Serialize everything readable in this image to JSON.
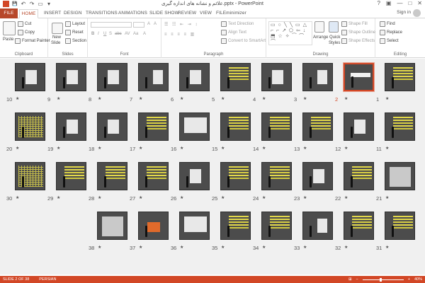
{
  "window": {
    "title": "علائم و نشانه های اندازه گیری.pptx - PowerPoint",
    "help": "?",
    "ribbon_display": "▣",
    "minimize": "—",
    "maximize": "□",
    "close": "✕"
  },
  "qat": {
    "save": "💾",
    "undo": "↶",
    "redo": "↷",
    "start": "▭",
    "customize": "▾"
  },
  "tabs": [
    "FILE",
    "HOME",
    "INSERT",
    "DESIGN",
    "TRANSITIONS",
    "ANIMATIONS",
    "SLIDE SHOW",
    "REVIEW",
    "VIEW",
    "FILEminimizer"
  ],
  "signin": "Sign in",
  "ribbon": {
    "clipboard": {
      "paste": "Paste",
      "cut": "Cut",
      "copy": "Copy",
      "format_painter": "Format Painter",
      "label": "Clipboard"
    },
    "slides": {
      "new_slide": "New",
      "new_slide2": "Slide",
      "layout": "Layout",
      "reset": "Reset",
      "section": "Section",
      "label": "Slides"
    },
    "font": {
      "label": "Font",
      "b": "B",
      "i": "I",
      "u": "U",
      "s": "S",
      "abc": "abc",
      "av": "AV",
      "aa": "Aa",
      "a": "A"
    },
    "paragraph": {
      "text_direction": "Text Direction",
      "align_text": "Align Text",
      "convert": "Convert to SmartArt",
      "label": "Paragraph"
    },
    "drawing": {
      "arrange": "Arrange",
      "quick_styles": "Quick",
      "quick_styles2": "Styles",
      "shape_fill": "Shape Fill",
      "shape_outline": "Shape Outline",
      "shape_effects": "Shape Effects",
      "shapes": "▭ ○ ╲ ╲ ▭ △ ⌐ ⌐ ↗ ⬠ ⇦ ↓ ⬒ ☆ ✧ ⁀ ⌒ ⌒",
      "label": "Drawing"
    },
    "editing": {
      "find": "Find",
      "replace": "Replace",
      "select": "Select",
      "label": "Editing"
    }
  },
  "slides": [
    {
      "n": "1",
      "type": "txt"
    },
    {
      "n": "2",
      "type": "title",
      "selected": true
    },
    {
      "n": "3",
      "type": "fig"
    },
    {
      "n": "4",
      "type": "doc"
    },
    {
      "n": "5",
      "type": "txt"
    },
    {
      "n": "6",
      "type": "doc"
    },
    {
      "n": "7",
      "type": "fig"
    },
    {
      "n": "8",
      "type": "doc"
    },
    {
      "n": "9",
      "type": "doc"
    },
    {
      "n": "10",
      "type": "doc"
    },
    {
      "n": "11",
      "type": "txt"
    },
    {
      "n": "12",
      "type": "doc"
    },
    {
      "n": "13",
      "type": "txt"
    },
    {
      "n": "14",
      "type": "txt"
    },
    {
      "n": "15",
      "type": "txt"
    },
    {
      "n": "16",
      "type": "wide"
    },
    {
      "n": "17",
      "type": "txt"
    },
    {
      "n": "18",
      "type": "doc"
    },
    {
      "n": "19",
      "type": "doc"
    },
    {
      "n": "20",
      "type": "grid"
    },
    {
      "n": "21",
      "type": "pic"
    },
    {
      "n": "22",
      "type": "txt"
    },
    {
      "n": "23",
      "type": "doc"
    },
    {
      "n": "24",
      "type": "txt"
    },
    {
      "n": "25",
      "type": "txt"
    },
    {
      "n": "26",
      "type": "doc"
    },
    {
      "n": "27",
      "type": "txt"
    },
    {
      "n": "28",
      "type": "txt"
    },
    {
      "n": "29",
      "type": "txt"
    },
    {
      "n": "30",
      "type": "grid"
    },
    {
      "n": "31",
      "type": "txt"
    },
    {
      "n": "32",
      "type": "txt"
    },
    {
      "n": "33",
      "type": "fig"
    },
    {
      "n": "34",
      "type": "txt"
    },
    {
      "n": "35",
      "type": "txt"
    },
    {
      "n": "36",
      "type": "wide"
    },
    {
      "n": "37",
      "type": "orange"
    },
    {
      "n": "38",
      "type": "pic"
    }
  ],
  "status": {
    "slide": "SLIDE 2 OF 38",
    "lang": "PERSIAN",
    "zoom_minus": "−",
    "zoom_plus": "+",
    "zoom": "40%",
    "zoom_fraction": 0.4,
    "fit": "⊞"
  },
  "colors": {
    "accent": "#d24726",
    "file_tab": "#b7472a"
  }
}
